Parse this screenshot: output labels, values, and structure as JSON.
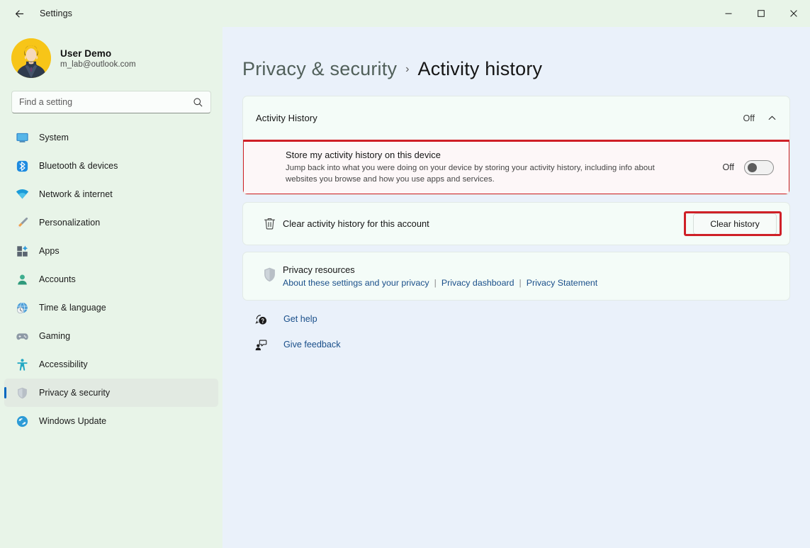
{
  "window": {
    "title": "Settings",
    "back_label": "Back",
    "controls": {
      "minimize": "Minimize",
      "maximize": "Maximize",
      "close": "Close"
    }
  },
  "account": {
    "name": "User Demo",
    "email": "m_lab@outlook.com"
  },
  "search": {
    "placeholder": "Find a setting",
    "value": ""
  },
  "sidebar": {
    "items": [
      {
        "label": "System",
        "icon": "monitor-icon",
        "selected": false
      },
      {
        "label": "Bluetooth & devices",
        "icon": "bluetooth-icon",
        "selected": false
      },
      {
        "label": "Network & internet",
        "icon": "wifi-icon",
        "selected": false
      },
      {
        "label": "Personalization",
        "icon": "paintbrush-icon",
        "selected": false
      },
      {
        "label": "Apps",
        "icon": "apps-grid-icon",
        "selected": false
      },
      {
        "label": "Accounts",
        "icon": "person-icon",
        "selected": false
      },
      {
        "label": "Time & language",
        "icon": "clock-globe-icon",
        "selected": false
      },
      {
        "label": "Gaming",
        "icon": "gamepad-icon",
        "selected": false
      },
      {
        "label": "Accessibility",
        "icon": "accessibility-icon",
        "selected": false
      },
      {
        "label": "Privacy & security",
        "icon": "shield-icon",
        "selected": true
      },
      {
        "label": "Windows Update",
        "icon": "update-refresh-icon",
        "selected": false
      }
    ]
  },
  "breadcrumb": {
    "parent": "Privacy & security",
    "separator": "›",
    "current": "Activity history"
  },
  "main": {
    "activity_history_expander": {
      "title": "Activity History",
      "state": "Off",
      "chevron": "chevron-up-icon"
    },
    "store_activity": {
      "title": "Store my activity history on this device",
      "description": "Jump back into what you were doing on your device by storing your activity history, including info about websites you browse and how you use apps and services.",
      "state": "Off",
      "toggle_on": false,
      "highlighted": true
    },
    "clear_history": {
      "icon": "trash-icon",
      "label": "Clear activity history for this account",
      "button_label": "Clear history",
      "highlighted": true
    },
    "privacy_resources": {
      "icon": "shield-icon",
      "title": "Privacy resources",
      "links": [
        "About these settings and your privacy",
        "Privacy dashboard",
        "Privacy Statement"
      ],
      "link_separator": "|"
    },
    "footer_links": [
      {
        "label": "Get help",
        "icon": "help-question-icon"
      },
      {
        "label": "Give feedback",
        "icon": "feedback-person-icon"
      }
    ]
  },
  "colors": {
    "accent": "#0067c0",
    "annotation_red": "#cf2027",
    "link": "#1a4f8a",
    "titlebar_bg": "#e8f4e8",
    "content_bg": "#eaf1fa",
    "card_bg": "#f4fcf8"
  }
}
